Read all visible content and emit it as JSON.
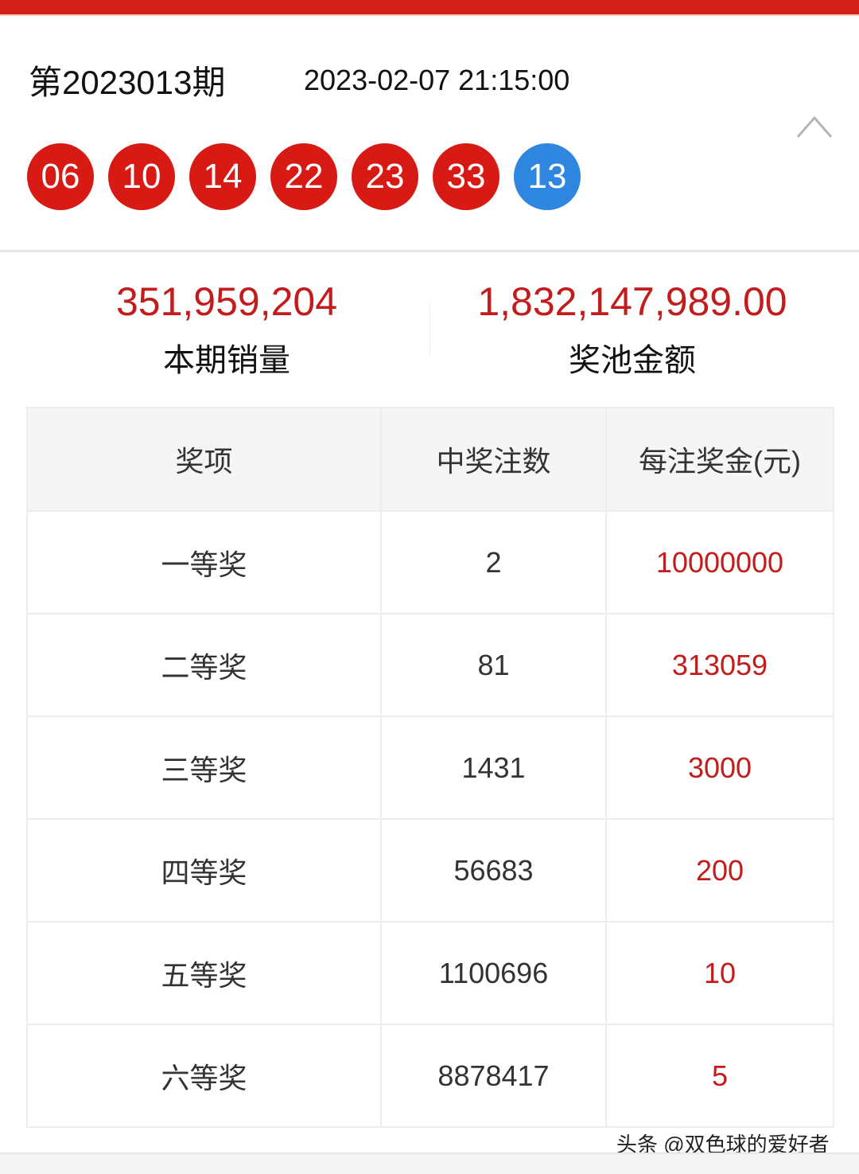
{
  "header": {
    "issue": "第2023013期",
    "datetime": "2023-02-07 21:15:00",
    "collapse_icon": "chevron-up-icon"
  },
  "balls": {
    "red": [
      "06",
      "10",
      "14",
      "22",
      "23",
      "33"
    ],
    "blue": [
      "13"
    ],
    "red_color": "#d81a15",
    "blue_color": "#2e86de"
  },
  "stats": {
    "sales_value": "351,959,204",
    "sales_label": "本期销量",
    "pool_value": "1,832,147,989.00",
    "pool_label": "奖池金额"
  },
  "table": {
    "headers": [
      "奖项",
      "中奖注数",
      "每注奖金(元)"
    ],
    "rows": [
      {
        "level": "一等奖",
        "count": "2",
        "prize": "10000000"
      },
      {
        "level": "二等奖",
        "count": "81",
        "prize": "313059"
      },
      {
        "level": "三等奖",
        "count": "1431",
        "prize": "3000"
      },
      {
        "level": "四等奖",
        "count": "56683",
        "prize": "200"
      },
      {
        "level": "五等奖",
        "count": "1100696",
        "prize": "10"
      },
      {
        "level": "六等奖",
        "count": "8878417",
        "prize": "5"
      }
    ]
  },
  "watermark": "头条 @双色球的爱好者",
  "colors": {
    "accent_red": "#d21f1a",
    "value_red": "#c31c1c"
  }
}
